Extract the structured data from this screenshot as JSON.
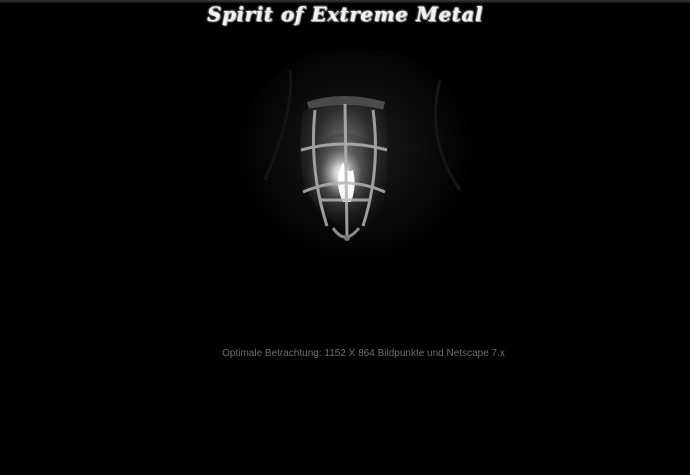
{
  "header": {
    "title": "Spirit of Extreme Metal"
  },
  "hero": {
    "image_subject": "caged-lantern-flame"
  },
  "footer": {
    "hint": "Optimale Betrachtung: 1152 X 864 Bildpunkte und Netscape 7.x"
  },
  "colors": {
    "background": "#000000",
    "title": "#f2f2f2",
    "hint": "#6e6e6e"
  }
}
